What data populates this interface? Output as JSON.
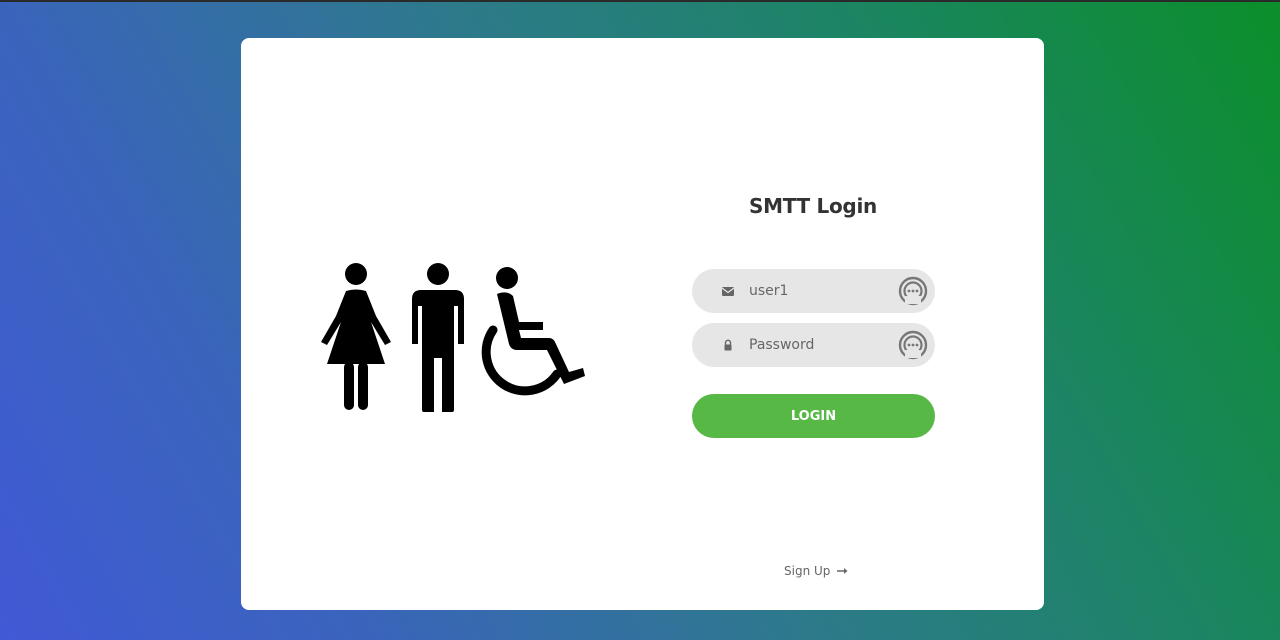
{
  "login": {
    "title": "SMTT Login",
    "username_value": "user1",
    "password_placeholder": "Password",
    "submit_label": "LOGIN",
    "signup_label": "Sign Up"
  },
  "icons": {
    "illustration": [
      "woman-icon",
      "man-icon",
      "wheelchair-icon"
    ],
    "username_field": "envelope-icon",
    "password_field": "lock-icon",
    "password_manager": "password-manager-icon",
    "signup": "arrow-right-icon"
  },
  "colors": {
    "background_gradient": [
      "#4159d6",
      "#2d7a8a",
      "#0b8f2a"
    ],
    "card": "#ffffff",
    "field": "#e6e6e6",
    "button": "#57b846",
    "text": "#333333"
  }
}
